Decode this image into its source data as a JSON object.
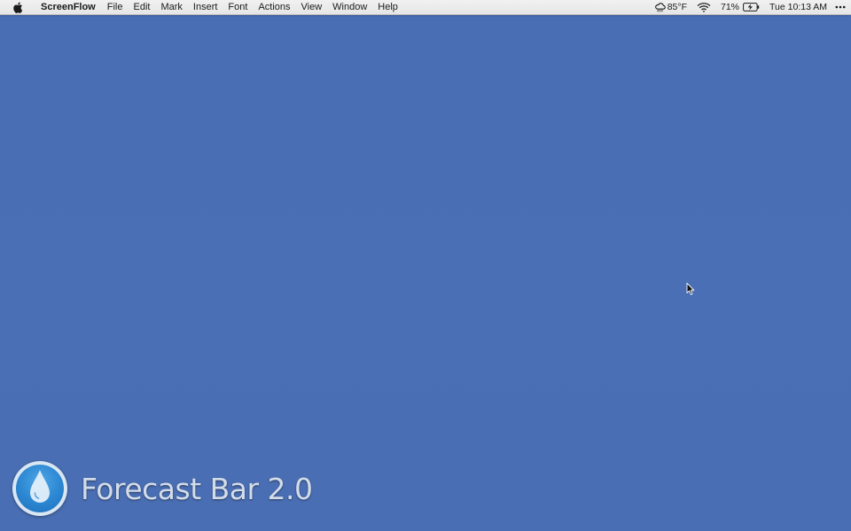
{
  "menubar": {
    "app_name": "ScreenFlow",
    "items": [
      "File",
      "Edit",
      "Mark",
      "Insert",
      "Font",
      "Actions",
      "View",
      "Window",
      "Help"
    ],
    "status": {
      "weather": "85°F",
      "battery": "71%",
      "clock": "Tue 10:13 AM"
    }
  },
  "watermark": {
    "text": "Forecast Bar 2.0"
  },
  "colors": {
    "desktop_background": "#4a6fb4",
    "menubar_background": "#ececec",
    "logo_blue": "#2b86d1"
  },
  "icons": [
    "apple-icon",
    "weather-cloud-icon",
    "wifi-icon",
    "battery-charging-icon",
    "more-icon",
    "raindrop-icon",
    "mouse-pointer-icon"
  ]
}
